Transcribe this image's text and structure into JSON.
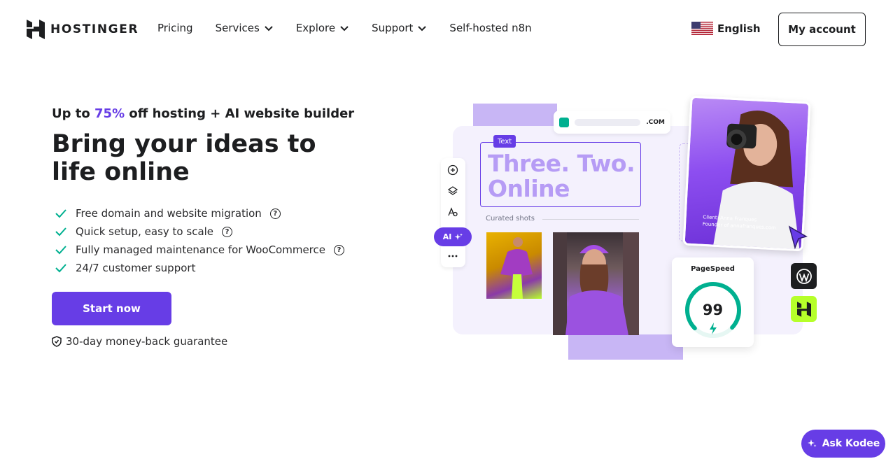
{
  "header": {
    "logo_text": "HOSTINGER",
    "nav": [
      {
        "label": "Pricing"
      },
      {
        "label": "Services"
      },
      {
        "label": "Explore"
      },
      {
        "label": "Support"
      },
      {
        "label": "Self-hosted n8n"
      }
    ],
    "language": "English",
    "account_label": "My account"
  },
  "hero": {
    "promo_prefix": "Up to ",
    "promo_highlight": "75%",
    "promo_suffix": " off hosting + AI website builder",
    "title": "Bring your ideas to life online",
    "features": [
      {
        "text": "Free domain and website migration",
        "has_info": true
      },
      {
        "text": "Quick setup, easy to scale",
        "has_info": true
      },
      {
        "text": "Fully managed maintenance for WooCommerce",
        "has_info": true
      },
      {
        "text": "24/7 customer support",
        "has_info": false
      }
    ],
    "cta_label": "Start now",
    "guarantee": "30-day money-back guarantee"
  },
  "illustration": {
    "url_tld": ".COM",
    "text_tag": "Text",
    "headline_line1": "Three. Two.",
    "headline_line2": "Online",
    "curated_label": "Curated shots",
    "ai_label": "AI",
    "client_line1": "Client: Anna Franques",
    "client_line2": "Founder of annafranques.com",
    "pagespeed_label": "PageSpeed",
    "pagespeed_score": "99",
    "pagespeed_fraction": 0.99
  },
  "chat": {
    "label": "Ask Kodee"
  },
  "colors": {
    "brand": "#673de6",
    "lime": "#b6ff2a",
    "success": "#00b090",
    "text": "#1d1e20"
  }
}
